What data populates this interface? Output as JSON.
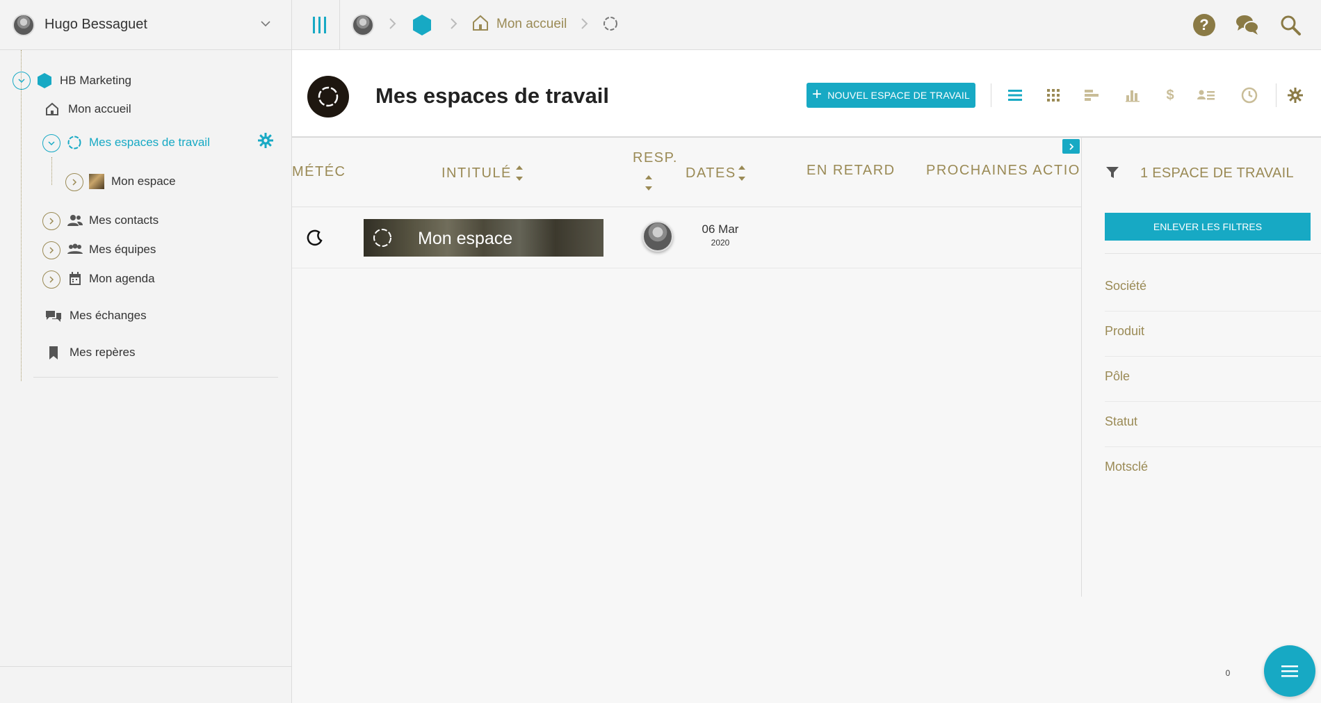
{
  "sidebar": {
    "username": "Hugo Bessaguet",
    "org": {
      "label": "HB Marketing",
      "color": "#17a9c4"
    },
    "items": [
      {
        "key": "home",
        "label": "Mon accueil",
        "icon": "home-icon"
      },
      {
        "key": "workspaces",
        "label": "Mes espaces de travail",
        "icon": "ring-icon",
        "active": true
      },
      {
        "key": "my-space",
        "label": "Mon espace",
        "icon": "thumbnail-icon"
      },
      {
        "key": "contacts",
        "label": "Mes contacts",
        "icon": "contacts-icon"
      },
      {
        "key": "teams",
        "label": "Mes équipes",
        "icon": "teams-icon"
      },
      {
        "key": "agenda",
        "label": "Mon agenda",
        "icon": "calendar-icon"
      },
      {
        "key": "exchanges",
        "label": "Mes échanges",
        "icon": "chat-icon"
      },
      {
        "key": "bookmarks",
        "label": "Mes repères",
        "icon": "bookmark-icon"
      }
    ]
  },
  "topbar": {
    "breadcrumb": {
      "home_label": "Mon accueil"
    },
    "icons": [
      "help-icon",
      "chat-icon",
      "search-icon"
    ]
  },
  "page": {
    "title": "Mes espaces de travail",
    "new_button": "NOUVEL ESPACE DE TRAVAIL",
    "view_icons": [
      "list-view-icon",
      "grid-view-icon",
      "gantt-view-icon",
      "chart-view-icon",
      "dollar-icon",
      "people-list-icon",
      "clock-icon",
      "settings-icon"
    ]
  },
  "table": {
    "columns": {
      "meteo": "MÉTÉC",
      "title": "INTITULÉ",
      "resp": "RESP.",
      "dates": "DATES",
      "late": "EN RETARD",
      "next": "PROCHAINES ACTIONS"
    },
    "rows": [
      {
        "title": "Mon espace",
        "date_day": "06 Mar",
        "date_year": "2020"
      }
    ]
  },
  "filters": {
    "count_label": "1 ESPACE DE TRAVAIL",
    "clear_label": "ENLEVER LES FILTRES",
    "items": [
      "Société",
      "Produit",
      "Pôle",
      "Statut",
      "Motsclé"
    ]
  },
  "fab": {
    "badge": "0"
  },
  "colors": {
    "accent": "#17a9c4",
    "gold": "#9a8a55",
    "dark": "#1e1710"
  }
}
